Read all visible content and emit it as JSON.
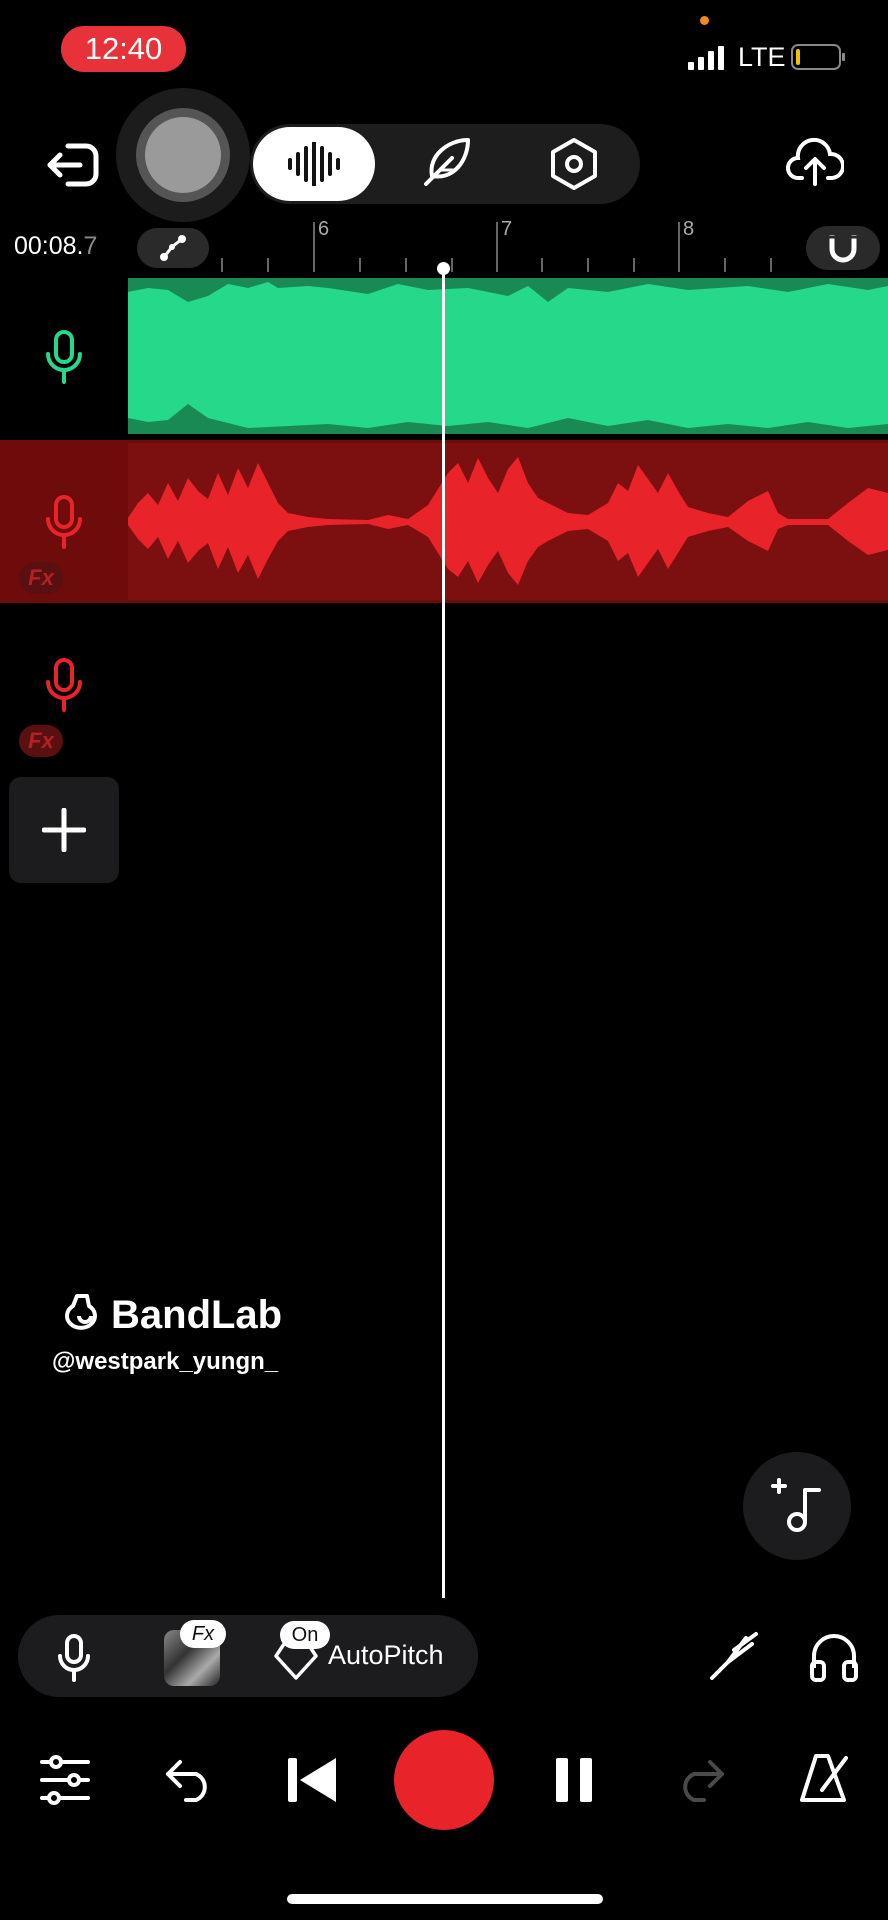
{
  "status_bar": {
    "time": "12:40",
    "network": "LTE",
    "colors": {
      "time_pill": "#e8323a",
      "battery_low": "#f2c100"
    }
  },
  "header": {
    "back_icon": "exit-icon",
    "mode_tabs": [
      {
        "icon": "waveform-icon",
        "active": true
      },
      {
        "icon": "feather-icon",
        "active": false
      },
      {
        "icon": "settings-hex-icon",
        "active": false
      }
    ],
    "upload_icon": "cloud-upload-icon"
  },
  "timeline": {
    "position_main": "00:08.",
    "position_fraction": "7",
    "ruler_marks": [
      "6",
      "7",
      "8"
    ],
    "automation_icon": "automation-icon",
    "snap_icon": "magnet-icon"
  },
  "tracks": [
    {
      "icon": "mic-icon",
      "color": "#26d98a",
      "fx": false
    },
    {
      "icon": "mic-icon",
      "color": "#e8232a",
      "fx": true,
      "fx_label": "Fx"
    },
    {
      "icon": "mic-icon",
      "color": "#e8232a",
      "fx": true,
      "fx_label": "Fx"
    }
  ],
  "add_track_icon": "plus-icon",
  "watermark": {
    "brand": "BandLab",
    "handle": "@westpark_yungn_"
  },
  "fab_icon": "add-music-icon",
  "input_bar": {
    "mic_icon": "mic-icon",
    "fx_badge": "Fx",
    "on_badge": "On",
    "autopitch_label": "AutoPitch"
  },
  "right_tools": {
    "tuner_icon": "tuning-fork-icon",
    "monitor_icon": "headphones-icon"
  },
  "transport": {
    "mixer_icon": "sliders-icon",
    "undo_icon": "undo-icon",
    "rewind_icon": "skip-back-icon",
    "record_color": "#e8232a",
    "pause_icon": "pause-icon",
    "redo_icon": "redo-icon",
    "metronome_icon": "metronome-icon"
  }
}
